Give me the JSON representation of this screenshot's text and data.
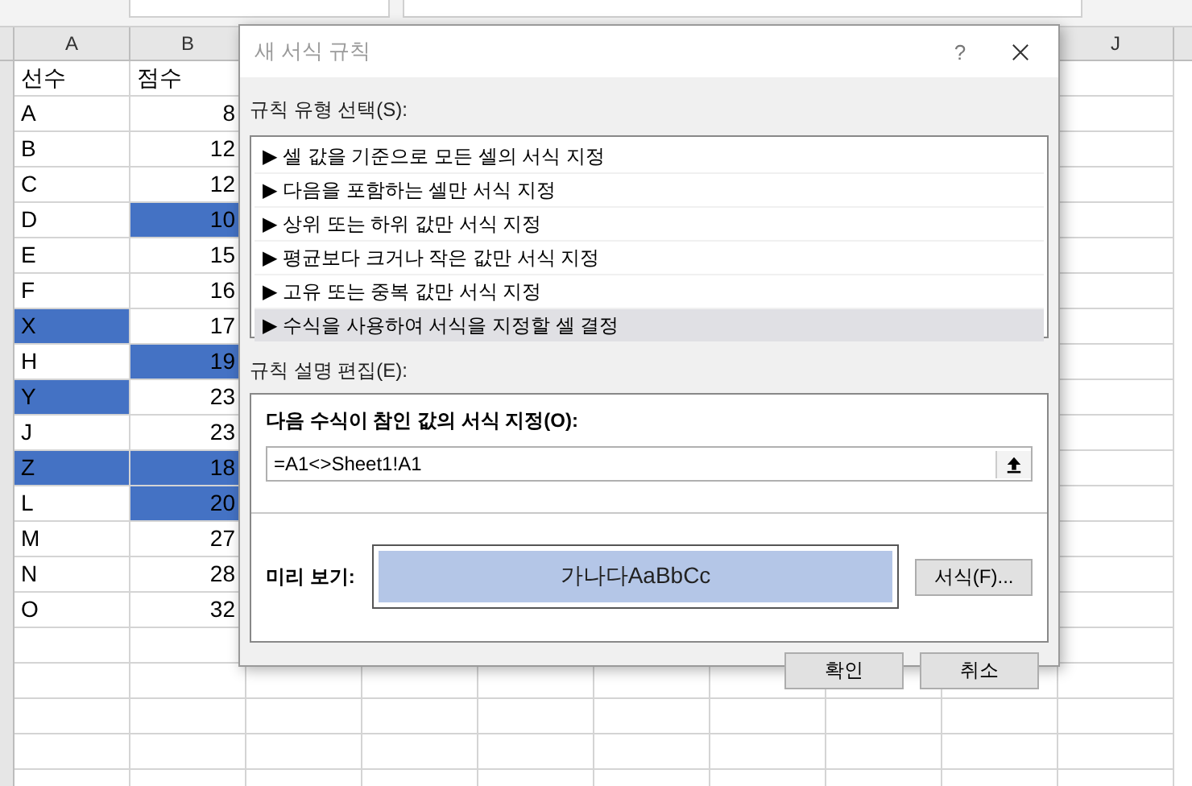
{
  "sheet": {
    "columns": [
      {
        "label": "A"
      },
      {
        "label": "B"
      }
    ],
    "far_column": {
      "label": "J"
    },
    "rows": [
      {
        "kind": "header",
        "a": "선수",
        "b": "점수",
        "a_highlighted": false,
        "b_highlighted": false
      },
      {
        "kind": "data",
        "a": "A",
        "b": "8",
        "a_highlighted": false,
        "b_highlighted": false
      },
      {
        "kind": "data",
        "a": "B",
        "b": "12",
        "a_highlighted": false,
        "b_highlighted": false
      },
      {
        "kind": "data",
        "a": "C",
        "b": "12",
        "a_highlighted": false,
        "b_highlighted": false
      },
      {
        "kind": "data",
        "a": "D",
        "b": "10",
        "a_highlighted": false,
        "b_highlighted": true
      },
      {
        "kind": "data",
        "a": "E",
        "b": "15",
        "a_highlighted": false,
        "b_highlighted": false
      },
      {
        "kind": "data",
        "a": "F",
        "b": "16",
        "a_highlighted": false,
        "b_highlighted": false
      },
      {
        "kind": "data",
        "a": "X",
        "b": "17",
        "a_highlighted": true,
        "b_highlighted": false
      },
      {
        "kind": "data",
        "a": "H",
        "b": "19",
        "a_highlighted": false,
        "b_highlighted": true
      },
      {
        "kind": "data",
        "a": "Y",
        "b": "23",
        "a_highlighted": true,
        "b_highlighted": false
      },
      {
        "kind": "data",
        "a": "J",
        "b": "23",
        "a_highlighted": false,
        "b_highlighted": false
      },
      {
        "kind": "data",
        "a": "Z",
        "b": "18",
        "a_highlighted": true,
        "b_highlighted": true
      },
      {
        "kind": "data",
        "a": "L",
        "b": "20",
        "a_highlighted": false,
        "b_highlighted": true
      },
      {
        "kind": "data",
        "a": "M",
        "b": "27",
        "a_highlighted": false,
        "b_highlighted": false
      },
      {
        "kind": "data",
        "a": "N",
        "b": "28",
        "a_highlighted": false,
        "b_highlighted": false
      },
      {
        "kind": "data",
        "a": "O",
        "b": "32",
        "a_highlighted": false,
        "b_highlighted": false
      }
    ]
  },
  "dialog": {
    "title": "새 서식 규칙",
    "help": "?",
    "rule_type_label": "규칙 유형 선택(S):",
    "rule_types": [
      {
        "label": "셀 값을 기준으로 모든 셀의 서식 지정",
        "selected": false
      },
      {
        "label": "다음을 포함하는 셀만 서식 지정",
        "selected": false
      },
      {
        "label": "상위 또는 하위 값만 서식 지정",
        "selected": false
      },
      {
        "label": "평균보다 크거나 작은 값만 서식 지정",
        "selected": false
      },
      {
        "label": "고유 또는 중복 값만 서식 지정",
        "selected": false
      },
      {
        "label": "수식을 사용하여 서식을 지정할 셀 결정",
        "selected": true
      }
    ],
    "item_marker": "▶",
    "description_label": "규칙 설명 편집(E):",
    "formula_label": "다음 수식이 참인 값의 서식 지정(O):",
    "formula": "=A1<>Sheet1!A1",
    "preview_label": "미리 보기:",
    "preview_text": "가나다AaBbCc",
    "format_button": "서식(F)...",
    "buttons": [
      "확인",
      "취소"
    ]
  }
}
